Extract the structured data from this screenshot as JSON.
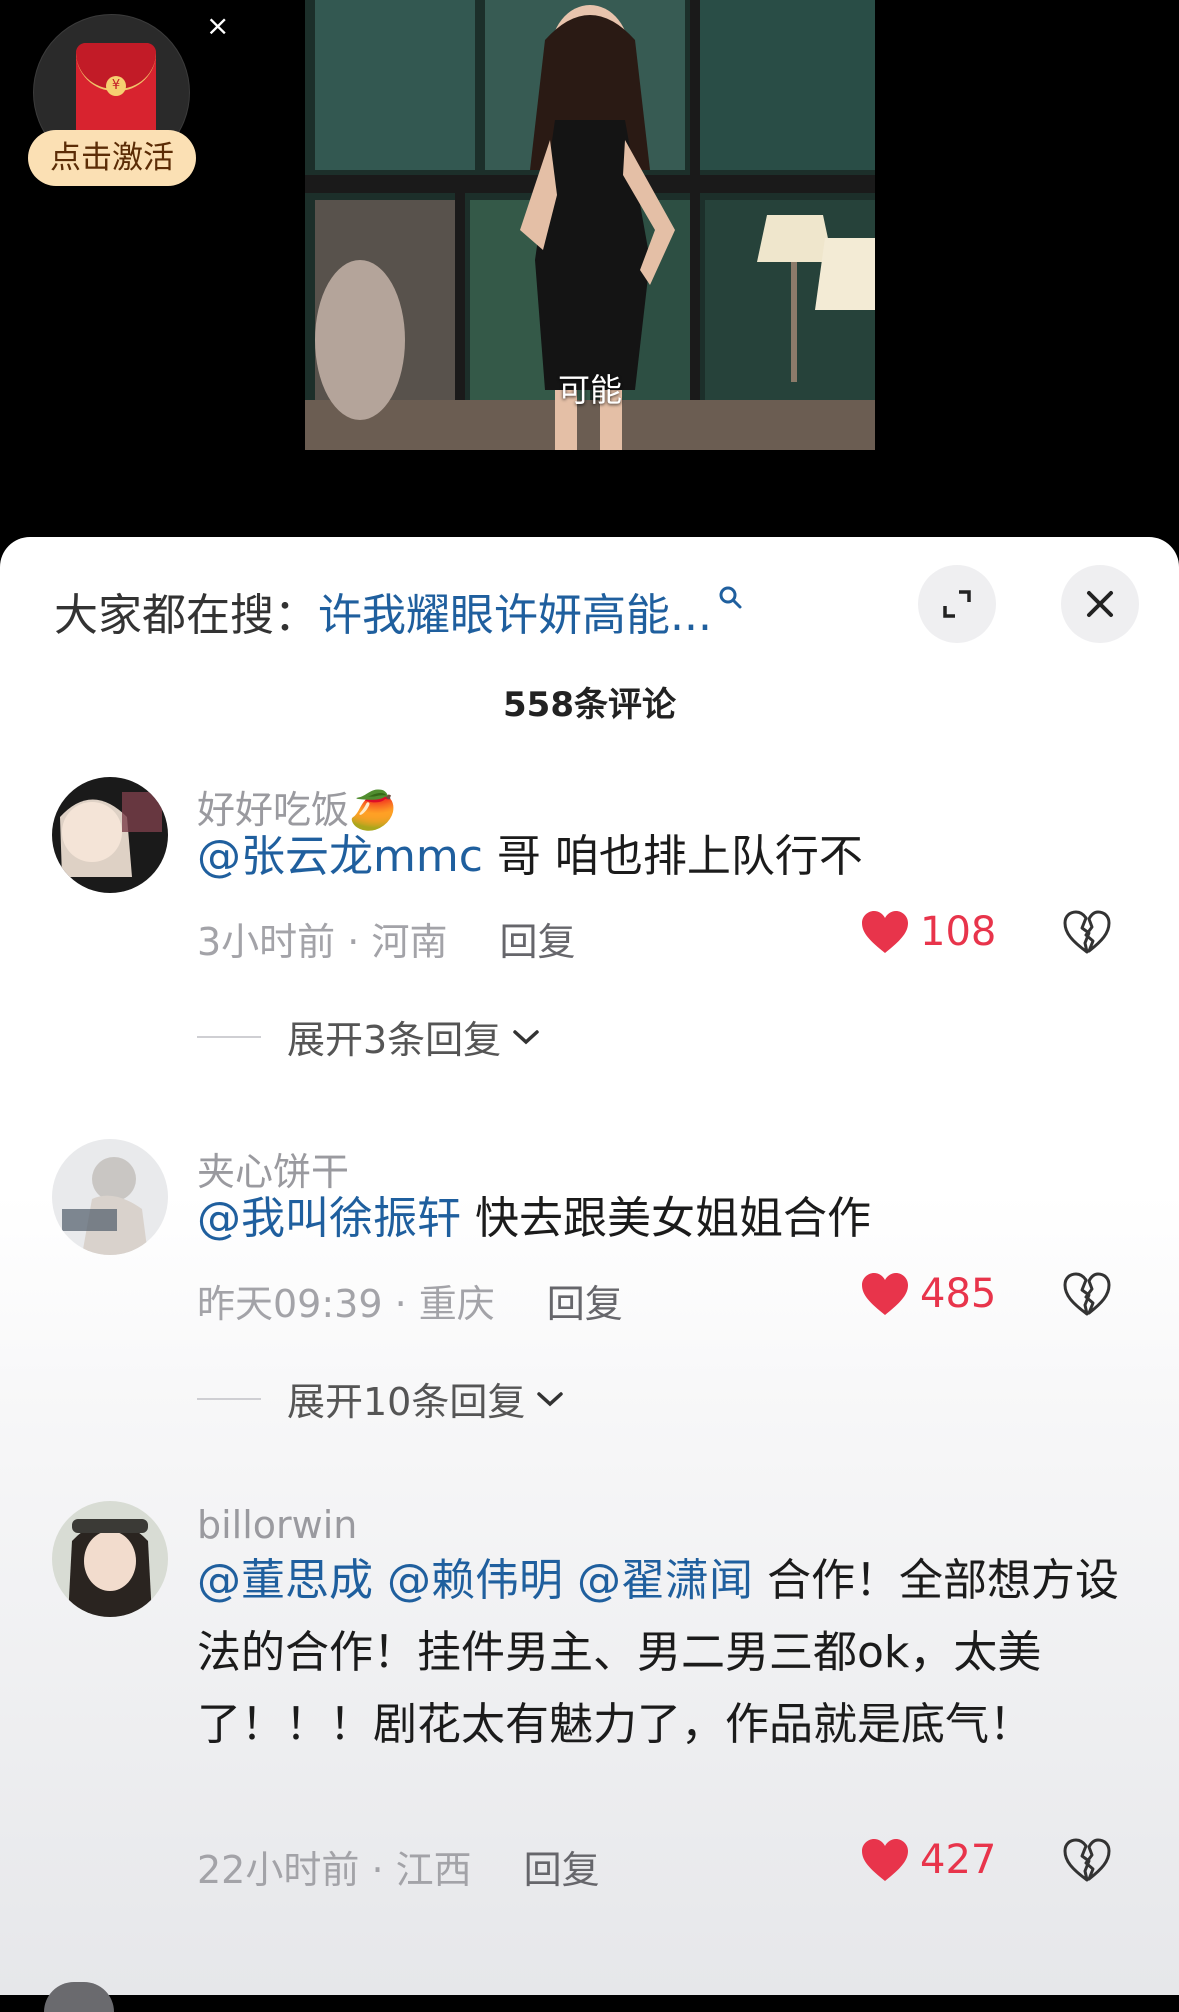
{
  "video": {
    "subtitle": "可能"
  },
  "redpacket": {
    "activate_label": "点击激活",
    "close_glyph": "×",
    "coin_glyph": "¥"
  },
  "search": {
    "prefix": "大家都在搜：",
    "query": "许我耀眼许妍高能..."
  },
  "comment_count_label": "558条评论",
  "comments": [
    {
      "username": "好好吃饭🥭",
      "mentions": [
        "@张云龙mmc"
      ],
      "text": " 哥 咱也排上队行不",
      "time": "3小时前",
      "location": "河南",
      "reply_label": "回复",
      "likes": "108",
      "expand_label": "展开3条回复"
    },
    {
      "username": "夹心饼干",
      "mentions": [
        "@我叫徐振轩"
      ],
      "text": " 快去跟美女姐姐合作",
      "time": "昨天09:39",
      "location": "重庆",
      "reply_label": "回复",
      "likes": "485",
      "expand_label": "展开10条回复"
    },
    {
      "username": "billorwin",
      "mentions": [
        "@董思成",
        "@赖伟明",
        "@翟潇闻"
      ],
      "text": " 合作！全部想方设法的合作！挂件男主、男二男三都ok，太美了！！！剧花太有魅力了，作品就是底气！",
      "time": "22小时前",
      "location": "江西",
      "reply_label": "回复",
      "likes": "427"
    }
  ],
  "colors": {
    "accent_link": "#1f5f9e",
    "like_red": "#e8344b",
    "panel_bg": "#ffffff"
  },
  "icons": {
    "search": "search-icon",
    "expand": "expand-icon",
    "close": "close-icon",
    "like": "heart-icon",
    "dislike": "broken-heart-icon",
    "chevron": "chevron-down-icon"
  }
}
